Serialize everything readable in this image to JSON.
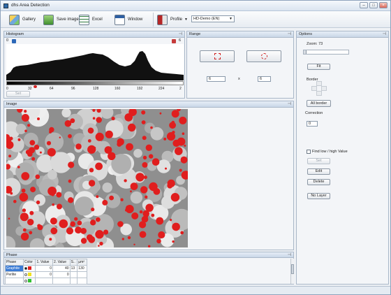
{
  "window": {
    "title": "dhs Area Detection"
  },
  "toolbar": {
    "gallery": "Gallery",
    "save_image": "Save image",
    "excel": "Excel",
    "window": "Window",
    "profile": "Profile",
    "profile_select": "HD-Demo (EN)"
  },
  "histogram": {
    "title": "Histogram",
    "left_value": "0",
    "right_value": "6",
    "ticks": [
      "0",
      "32",
      "64",
      "96",
      "128",
      "160",
      "192",
      "224",
      "2"
    ],
    "set_button": "Set"
  },
  "range": {
    "title": "Range",
    "x_value": "6",
    "sep": "x",
    "y_value": "6"
  },
  "options": {
    "title": "Options",
    "zoom_label": "Zoom: 73",
    "zoom_level": 0.0,
    "fit_button": "Fit",
    "border_label": "Border",
    "all_border_button": "All border",
    "correction_label": "Correction",
    "correction_value": "0",
    "find_label": "Find low / high Value",
    "set_button": "Set",
    "edit_button": "Edit",
    "delete_button": "Delete",
    "no_layer_button": "No Layer"
  },
  "image_panel": {
    "title": "Image"
  },
  "phase": {
    "title": "Phase",
    "headers": [
      "Phase",
      "Color",
      "1. Value",
      "2. Value",
      "S..",
      "µm²"
    ],
    "rows": [
      {
        "name": "Graphite",
        "color": "#e02020",
        "v1": "0",
        "v2": "40",
        "s": "13",
        "um": "130",
        "selected": true
      },
      {
        "name": "Perlite",
        "color": "#f0e020",
        "v1": "0",
        "v2": "0",
        "s": "",
        "um": "",
        "selected": false
      },
      {
        "name": "",
        "color": "#30c030",
        "v1": "",
        "v2": "",
        "s": "",
        "um": "",
        "selected": false
      },
      {
        "name": "",
        "color": "#30c0d0",
        "v1": "",
        "v2": "",
        "s": "",
        "um": "",
        "selected": false
      }
    ]
  },
  "colors": {
    "accent": "#3a7bd5",
    "red": "#e01e1e"
  }
}
